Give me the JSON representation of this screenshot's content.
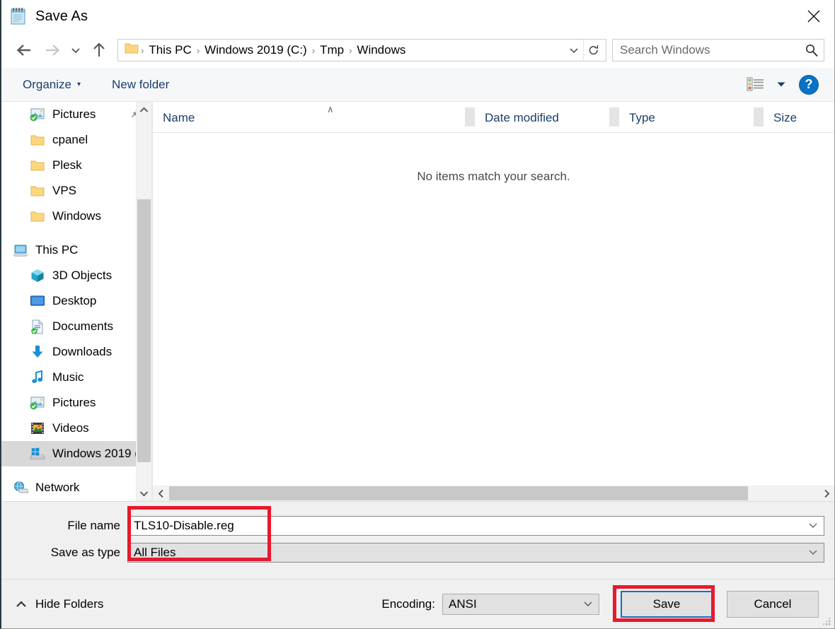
{
  "window": {
    "title": "Save As",
    "title_icon": "notepad-icon",
    "close_label": "✕"
  },
  "nav": {
    "back_icon": "arrow-left-icon",
    "forward_icon": "arrow-right-icon",
    "recent_icon": "chevron-down-icon",
    "up_icon": "arrow-up-icon",
    "breadcrumb": [
      "This PC",
      "Windows 2019 (C:)",
      "Tmp",
      "Windows"
    ],
    "breadcrumb_separator": "›",
    "expand_icon": "chevron-down-icon",
    "refresh_icon": "refresh-icon"
  },
  "search": {
    "placeholder": "Search Windows",
    "value": "",
    "icon": "search-icon"
  },
  "toolbar": {
    "organize_label": "Organize",
    "organize_caret": "▾",
    "new_folder_label": "New folder",
    "view_icon": "list-view-icon",
    "view_caret": "▾",
    "help_label": "?"
  },
  "sidebar": {
    "items": [
      {
        "label": "Pictures",
        "icon": "pictures-icon",
        "indent": 1,
        "pinned": true,
        "selected": false,
        "synced": true
      },
      {
        "label": "cpanel",
        "icon": "folder-icon",
        "indent": 1,
        "pinned": false,
        "selected": false
      },
      {
        "label": "Plesk",
        "icon": "folder-icon",
        "indent": 1,
        "pinned": false,
        "selected": false
      },
      {
        "label": "VPS",
        "icon": "folder-icon",
        "indent": 1,
        "pinned": false,
        "selected": false
      },
      {
        "label": "Windows",
        "icon": "folder-icon",
        "indent": 1,
        "pinned": false,
        "selected": false
      },
      {
        "label": "This PC",
        "icon": "this-pc-icon",
        "indent": 0,
        "pinned": false,
        "selected": false
      },
      {
        "label": "3D Objects",
        "icon": "3d-objects-icon",
        "indent": 1,
        "pinned": false,
        "selected": false
      },
      {
        "label": "Desktop",
        "icon": "desktop-icon",
        "indent": 1,
        "pinned": false,
        "selected": false
      },
      {
        "label": "Documents",
        "icon": "documents-icon",
        "indent": 1,
        "pinned": false,
        "selected": false,
        "synced": true
      },
      {
        "label": "Downloads",
        "icon": "downloads-icon",
        "indent": 1,
        "pinned": false,
        "selected": false
      },
      {
        "label": "Music",
        "icon": "music-icon",
        "indent": 1,
        "pinned": false,
        "selected": false
      },
      {
        "label": "Pictures",
        "icon": "pictures-icon",
        "indent": 1,
        "pinned": false,
        "selected": false,
        "synced": true
      },
      {
        "label": "Videos",
        "icon": "videos-icon",
        "indent": 1,
        "pinned": false,
        "selected": false
      },
      {
        "label": "Windows 2019 (",
        "icon": "drive-windows-icon",
        "indent": 1,
        "pinned": false,
        "selected": true
      },
      {
        "label": "Network",
        "icon": "network-icon",
        "indent": 0,
        "pinned": false,
        "selected": false
      }
    ],
    "scroll_up_icon": "chevron-up-icon",
    "scroll_down_icon": "chevron-down-icon"
  },
  "filelist": {
    "columns": [
      "Name",
      "Date modified",
      "Type",
      "Size"
    ],
    "sort_indicator": "∧",
    "sort_column": "Name",
    "rows": [],
    "empty_message": "No items match your search.",
    "hscroll_left_icon": "chevron-left-icon",
    "hscroll_right_icon": "chevron-right-icon"
  },
  "form": {
    "file_name_label": "File name",
    "file_name_value": "TLS10-Disable.reg",
    "save_as_type_label": "Save as type",
    "save_as_type_value": "All Files",
    "combo_caret": "chevron-down-icon"
  },
  "footer": {
    "hide_folders_label": "Hide Folders",
    "hide_folders_icon": "chevron-up-icon",
    "encoding_label": "Encoding:",
    "encoding_value": "ANSI",
    "encoding_caret": "chevron-down-icon",
    "save_label": "Save",
    "cancel_label": "Cancel"
  },
  "annotations": {
    "color": "#e8192c",
    "boxes": [
      "file-fields-highlight",
      "save-button-highlight"
    ]
  },
  "colors": {
    "accent_blue": "#0a72c4",
    "link_blue": "#1a3f6b",
    "annotation_red": "#e8192c",
    "selection_gray": "#d8d8d8",
    "chrome_gray": "#f0f0f0"
  }
}
